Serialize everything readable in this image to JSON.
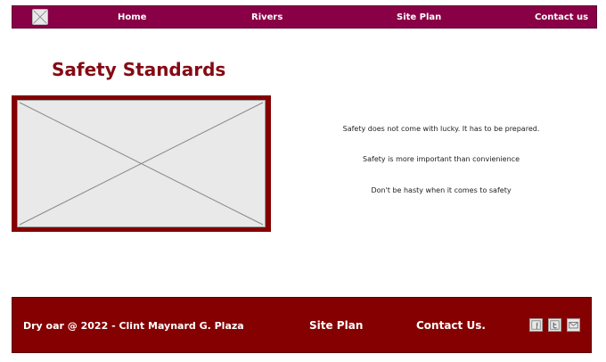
{
  "navbar": {
    "logo_icon": "image-placeholder-icon",
    "links": [
      "Home",
      "Rivers",
      "Site Plan",
      "Contact us"
    ]
  },
  "main": {
    "title": "Safety Standards",
    "image_icon": "image-placeholder-icon",
    "quotes": [
      "Safety does not come with lucky. It has to be prepared.",
      "Safety is more important than convienience",
      "Don't be hasty when it comes to safety"
    ]
  },
  "footer": {
    "copyright": "Dry oar @ 2022 - Clint Maynard G. Plaza",
    "site_plan": "Site Plan",
    "contact": "Contact Us.",
    "social_icons": [
      "facebook-icon",
      "twitter-icon",
      "mail-icon"
    ]
  },
  "colors": {
    "navbar_bg": "#8a0047",
    "title": "#850a14",
    "image_frame": "#850000",
    "footer_bg": "#850000"
  }
}
